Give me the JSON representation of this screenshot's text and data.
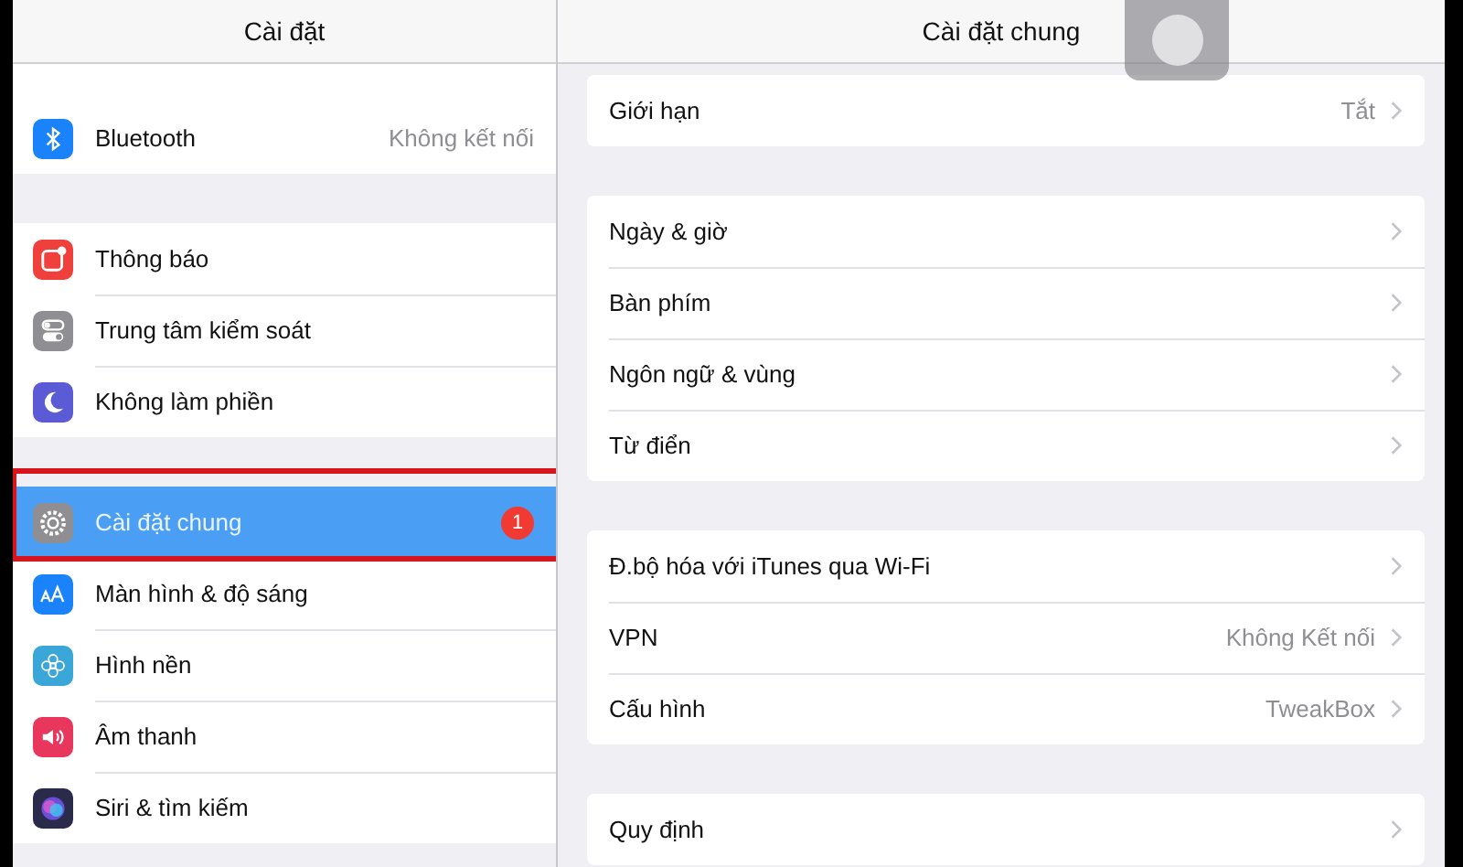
{
  "sidebar": {
    "title": "Cài đặt",
    "groups": [
      [
        {
          "label": "Bluetooth",
          "value": "Không kết nối",
          "kind": "bluetooth",
          "color": "#1a82fb",
          "selected": false
        }
      ],
      [
        {
          "label": "Thông báo",
          "kind": "notification",
          "color": "#f0403c",
          "selected": false
        },
        {
          "label": "Trung tâm kiểm soát",
          "kind": "toggles",
          "color": "#8e8e93",
          "selected": false
        },
        {
          "label": "Không làm phiền",
          "kind": "moon",
          "color": "#5b5bd6",
          "selected": false
        }
      ],
      [
        {
          "label": "Cài đặt chung",
          "kind": "gear",
          "color": "#8e8e93",
          "selected": true,
          "badge": "1"
        },
        {
          "label": "Màn hình & độ sáng",
          "kind": "textsize",
          "color": "#1a82fb",
          "selected": false
        },
        {
          "label": "Hình nền",
          "kind": "flower",
          "color": "#3aa7d8",
          "selected": false
        },
        {
          "label": "Âm thanh",
          "kind": "speaker",
          "color": "#e8365c",
          "selected": false
        },
        {
          "label": "Siri & tìm kiếm",
          "kind": "siri",
          "color": "#2a2a4a",
          "selected": false
        }
      ]
    ]
  },
  "detail": {
    "title": "Cài đặt chung",
    "groups": [
      [
        {
          "label": "Giới hạn",
          "value": "Tắt"
        }
      ],
      [
        {
          "label": "Ngày & giờ"
        },
        {
          "label": "Bàn phím"
        },
        {
          "label": "Ngôn ngữ & vùng"
        },
        {
          "label": "Từ điển"
        }
      ],
      [
        {
          "label": "Đ.bộ hóa với iTunes qua Wi-Fi"
        },
        {
          "label": "VPN",
          "value": "Không Kết nối"
        },
        {
          "label": "Cấu hình",
          "value": "TweakBox"
        }
      ],
      [
        {
          "label": "Quy định"
        }
      ]
    ]
  }
}
